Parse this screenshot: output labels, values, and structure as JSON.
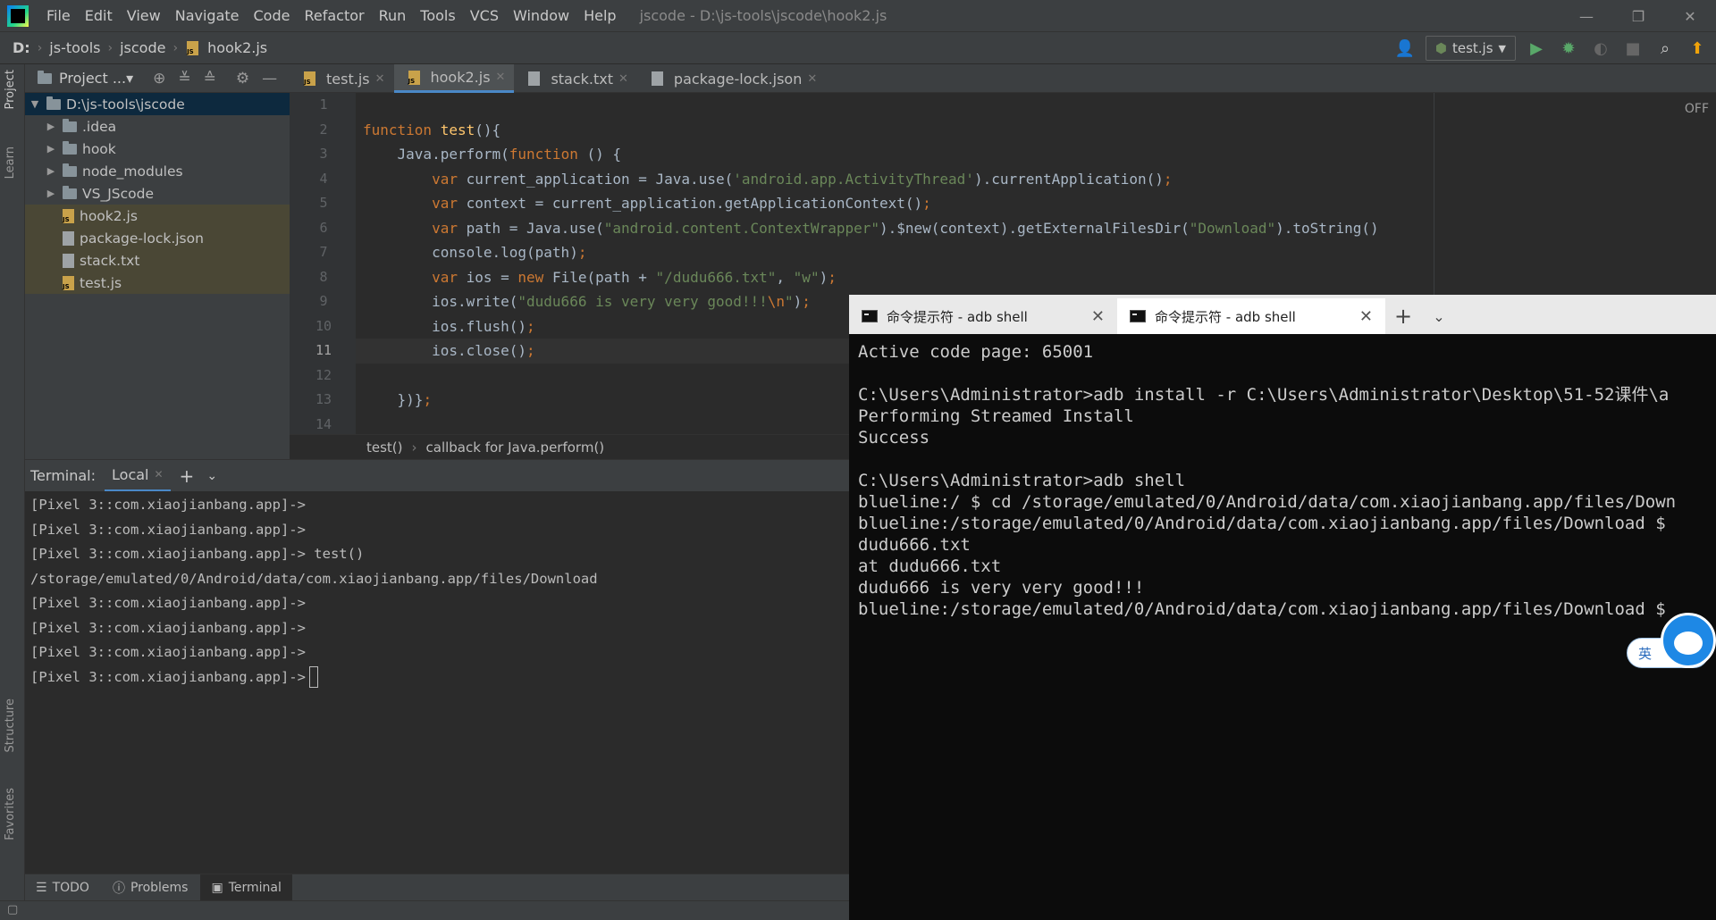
{
  "menubar": {
    "items": [
      "File",
      "Edit",
      "View",
      "Navigate",
      "Code",
      "Refactor",
      "Run",
      "Tools",
      "VCS",
      "Window",
      "Help"
    ],
    "title": "jscode - D:\\js-tools\\jscode\\hook2.js",
    "minimize": "—",
    "restore": "❐",
    "close": "✕"
  },
  "navbar": {
    "crumbs": [
      "D:",
      "js-tools",
      "jscode",
      "hook2.js"
    ],
    "run_config": "test.js"
  },
  "project": {
    "header": "Project ...▾",
    "root": "D:\\js-tools\\jscode",
    "items": [
      ".idea",
      "hook",
      "node_modules",
      "VS_JScode",
      "hook2.js",
      "package-lock.json",
      "stack.txt",
      "test.js"
    ]
  },
  "tabs": [
    "test.js",
    "hook2.js",
    "stack.txt",
    "package-lock.json"
  ],
  "editor": {
    "line_numbers": [
      "1",
      "2",
      "3",
      "4",
      "5",
      "6",
      "7",
      "8",
      "9",
      "10",
      "11",
      "12",
      "13",
      "14"
    ],
    "breadcrumb": [
      "test()",
      "callback for Java.perform()"
    ],
    "off_label": "OFF",
    "code": {
      "l2_kw": "function",
      "l2_fn": " test",
      "l2_rest": "(){",
      "l3_a": "    Java.perform(",
      "l3_kw": "function",
      "l3_b": " () {",
      "l4_kw": "        var",
      "l4_a": " current_application = Java.use(",
      "l4_str": "'android.app.ActivityThread'",
      "l4_b": ").currentApplication()",
      "l5_kw": "        var",
      "l5_a": " context = current_application.getApplicationContext()",
      "l6_kw": "        var",
      "l6_a": " path = Java.use(",
      "l6_str1": "\"android.content.ContextWrapper\"",
      "l6_b": ").$new(context).getExternalFilesDir(",
      "l6_str2": "\"Download\"",
      "l6_c": ").toString()",
      "l7_a": "        console.log(path)",
      "l8_kw": "        var",
      "l8_a": " ios = ",
      "l8_kw2": "new",
      "l8_b": " File(path + ",
      "l8_str1": "\"/dudu666.txt\"",
      "l8_c": ", ",
      "l8_str2": "\"w\"",
      "l8_d": ")",
      "l9_a": "        ios.write(",
      "l9_str": "\"dudu666 is very very good!!!",
      "l9_esc": "\\n",
      "l9_str2": "\"",
      "l9_b": ")",
      "l10_a": "        ios.flush()",
      "l11_a": "        ios.close()",
      "l13_a": "    })}",
      "semi": ";"
    }
  },
  "terminal": {
    "label": "Terminal:",
    "tab": "Local",
    "lines": [
      "[Pixel 3::com.xiaojianbang.app]->",
      "[Pixel 3::com.xiaojianbang.app]->",
      "[Pixel 3::com.xiaojianbang.app]-> test()",
      "/storage/emulated/0/Android/data/com.xiaojianbang.app/files/Download",
      "[Pixel 3::com.xiaojianbang.app]->",
      "[Pixel 3::com.xiaojianbang.app]->",
      "[Pixel 3::com.xiaojianbang.app]->",
      "[Pixel 3::com.xiaojianbang.app]->"
    ]
  },
  "bottom_tabs": [
    "TODO",
    "Problems",
    "Terminal"
  ],
  "left_strip": [
    "Project",
    "Learn",
    "Structure",
    "Favorites"
  ],
  "cmd": {
    "tab_title": "命令提示符 - adb  shell",
    "lines": [
      "Active code page: 65001",
      "",
      "C:\\Users\\Administrator>adb install -r C:\\Users\\Administrator\\Desktop\\51-52课件\\a",
      "Performing Streamed Install",
      "Success",
      "",
      "C:\\Users\\Administrator>adb shell",
      "blueline:/ $ cd /storage/emulated/0/Android/data/com.xiaojianbang.app/files/Down",
      "blueline:/storage/emulated/0/Android/data/com.xiaojianbang.app/files/Download $",
      "dudu666.txt",
      "at dudu666.txt",
      "dudu666 is very very good!!!",
      "blueline:/storage/emulated/0/Android/data/com.xiaojianbang.app/files/Download $"
    ]
  },
  "ime": "英"
}
